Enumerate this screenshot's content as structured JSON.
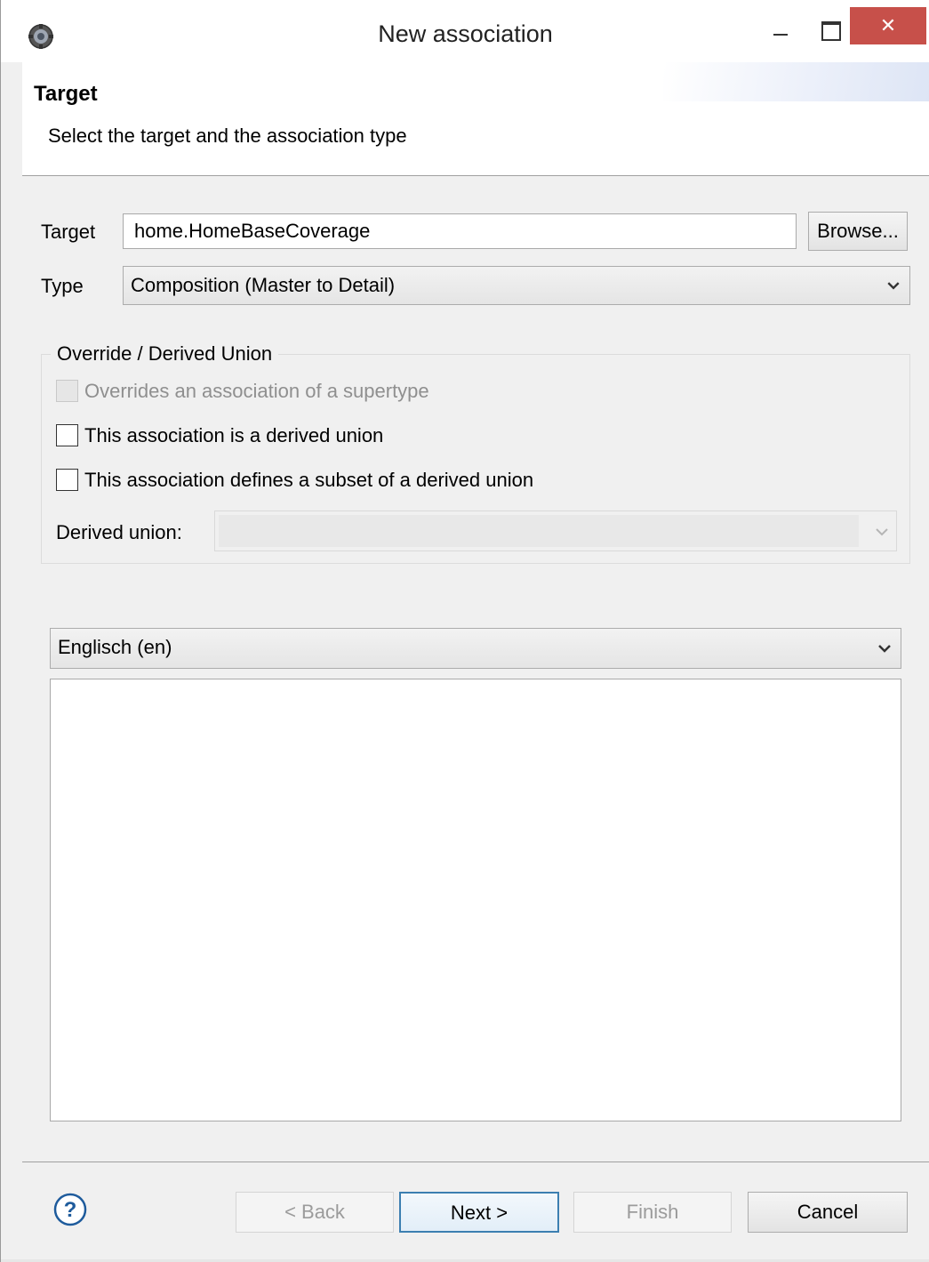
{
  "window": {
    "title": "New association",
    "close_glyph": "✕"
  },
  "header": {
    "title": "Target",
    "description": "Select the target and the association type"
  },
  "form": {
    "target_label": "Target",
    "target_value": "home.HomeBaseCoverage",
    "browse_label": "Browse...",
    "type_label": "Type",
    "type_value": "Composition (Master to Detail)"
  },
  "override_group": {
    "legend": "Override / Derived Union",
    "checkboxes": [
      {
        "label": "Overrides an association of a supertype",
        "checked": false,
        "enabled": false
      },
      {
        "label": "This association is a derived union",
        "checked": false,
        "enabled": true
      },
      {
        "label": "This association defines a subset of a derived union",
        "checked": false,
        "enabled": true
      }
    ],
    "derived_union_label": "Derived union:",
    "derived_union_value": ""
  },
  "language": {
    "selected": "Englisch (en)"
  },
  "description_text": "",
  "footer": {
    "back_label": "< Back",
    "next_label": "Next >",
    "finish_label": "Finish",
    "cancel_label": "Cancel"
  },
  "colors": {
    "close_button": "#c7504a",
    "default_button_border": "#3c7fb1",
    "help_icon": "#1e5b9c"
  },
  "icons": {
    "app": "eclipse-gear-icon",
    "help": "help-question-icon",
    "dropdown": "chevron-down-icon"
  }
}
